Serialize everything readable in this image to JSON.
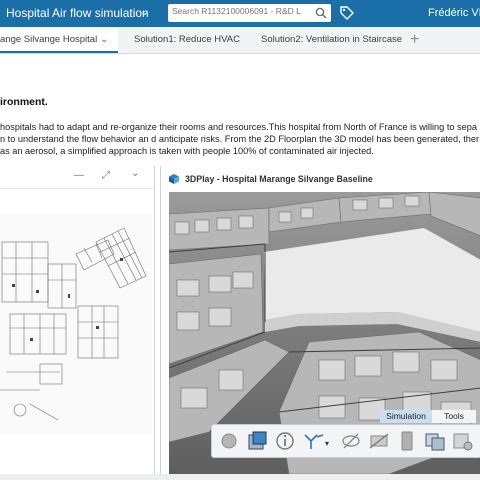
{
  "topbar": {
    "app_title": "Hospital Air flow simulation",
    "search_placeholder": "Search R1132100006091 - R&D L",
    "user_name": "Frédéric VR"
  },
  "tabs": [
    {
      "label": "ange Silvange Hospital",
      "active": true
    },
    {
      "label": "Solution1: Reduce HVAC",
      "active": false
    },
    {
      "label": "Solution2: Ventilation in Staircase",
      "active": false
    }
  ],
  "description": {
    "heading": "ironment.",
    "lines": [
      "hospitals had to adapt and re-organize their rooms and resources.This hospital from North of France is willing to sepa",
      "n to understand the flow behavior an d anticipate risks. From the 2D Floorplan the 3D model has been generated, ther",
      "as an aerosol, a simplified approach is taken with people 100% of contaminated air injected."
    ]
  },
  "left_panel": {
    "min_glyph": "—",
    "expand_glyph": "⤢",
    "chevron_glyph": "⌄"
  },
  "viewer": {
    "title": "3DPlay - Hospital Marange Silvange Baseline",
    "mode_tabs": [
      "Simulation",
      "Tools"
    ],
    "tools": [
      "sphere-icon",
      "cube-view-icon",
      "info-icon",
      "axis-icon",
      "hide-icon",
      "section-icon",
      "material-icon",
      "boxes-icon",
      "box-settings-icon"
    ]
  },
  "colors": {
    "header_blue": "#1a6fa8",
    "active_mode_tab": "#c9dff0",
    "viewer_floor": "#ececec",
    "walls": "#8e8e8e"
  }
}
